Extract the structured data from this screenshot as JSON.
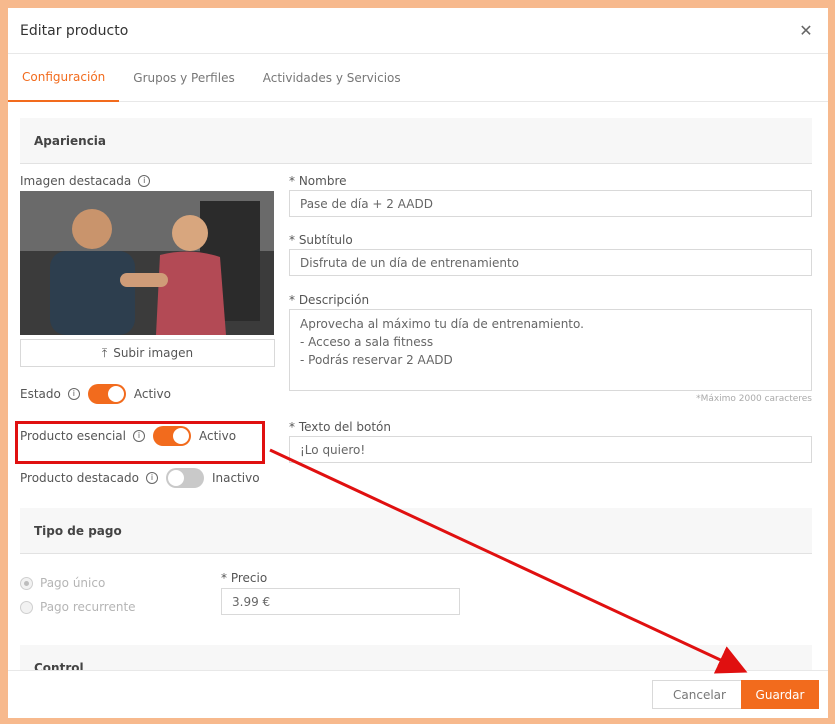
{
  "modal": {
    "title": "Editar producto",
    "close_icon": "close-icon"
  },
  "tabs": [
    {
      "label": "Configuración",
      "active": true
    },
    {
      "label": "Grupos y Perfiles",
      "active": false
    },
    {
      "label": "Actividades y Servicios",
      "active": false
    }
  ],
  "sections": {
    "appearance": "Apariencia",
    "payment": "Tipo de pago",
    "next": "Control"
  },
  "image": {
    "label": "Imagen destacada",
    "upload_label": "Subir imagen"
  },
  "toggles": {
    "estado": {
      "label": "Estado",
      "state": "Activo"
    },
    "esencial": {
      "label": "Producto esencial",
      "state": "Activo"
    },
    "destacado": {
      "label": "Producto destacado",
      "state": "Inactivo"
    }
  },
  "fields": {
    "nombre": {
      "label": "* Nombre",
      "value": "Pase de día + 2 AADD"
    },
    "subtitulo": {
      "label": "* Subtítulo",
      "value": "Disfruta de un día de entrenamiento"
    },
    "descripcion": {
      "label": "* Descripción",
      "value": "Aprovecha al máximo tu día de entrenamiento.\n- Acceso a sala fitness\n- Podrás reservar 2 AADD",
      "hint": "*Máximo 2000 caracteres"
    },
    "texto_boton": {
      "label": "* Texto del botón",
      "value": "¡Lo quiero!"
    },
    "precio": {
      "label": "* Precio",
      "value": "3.99 €"
    }
  },
  "payment_options": [
    {
      "label": "Pago único",
      "checked": true
    },
    {
      "label": "Pago recurrente",
      "checked": false
    }
  ],
  "footer": {
    "cancel_label": "Cancelar",
    "save_label": "Guardar"
  },
  "colors": {
    "accent": "#f26b1d",
    "annotation": "#e01010",
    "frame": "#f7b98d"
  }
}
